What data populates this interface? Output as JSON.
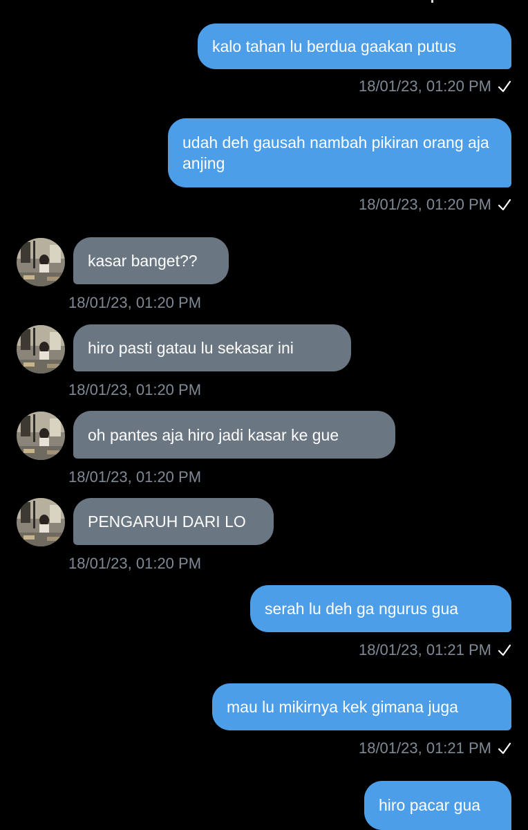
{
  "messages": [
    {
      "side": "out",
      "text": "kalo tahan lu berdua gaakan putus",
      "time": "18/01/23, 01:20 PM",
      "read_icon": "checkmark-icon"
    },
    {
      "side": "out",
      "text": "udah deh gausah nambah pikiran orang aja anjing",
      "time": "18/01/23, 01:20 PM",
      "read_icon": "checkmark-icon"
    },
    {
      "side": "in",
      "text": "kasar banget??",
      "time": "18/01/23, 01:20 PM"
    },
    {
      "side": "in",
      "text": "hiro pasti gatau lu sekasar ini",
      "time": "18/01/23, 01:20 PM"
    },
    {
      "side": "in",
      "text": "oh pantes aja hiro jadi kasar ke gue",
      "time": "18/01/23, 01:20 PM"
    },
    {
      "side": "in",
      "text": "PENGARUH DARI LO",
      "time": "18/01/23, 01:20 PM"
    },
    {
      "side": "out",
      "text": "serah lu deh ga ngurus gua",
      "time": "18/01/23, 01:21 PM",
      "read_icon": "checkmark-icon"
    },
    {
      "side": "out",
      "text": "mau lu mikirnya kek gimana juga",
      "time": "18/01/23, 01:21 PM",
      "read_icon": "checkmark-icon"
    },
    {
      "side": "out",
      "text": "hiro pacar gua"
    }
  ],
  "colors": {
    "background": "#000000",
    "outgoing_bubble": "#4d9ee9",
    "incoming_bubble": "#6b7683",
    "timestamp": "#7f8a96",
    "text": "#ffffff"
  },
  "avatar": {
    "icon": "contact-avatar-photo"
  }
}
